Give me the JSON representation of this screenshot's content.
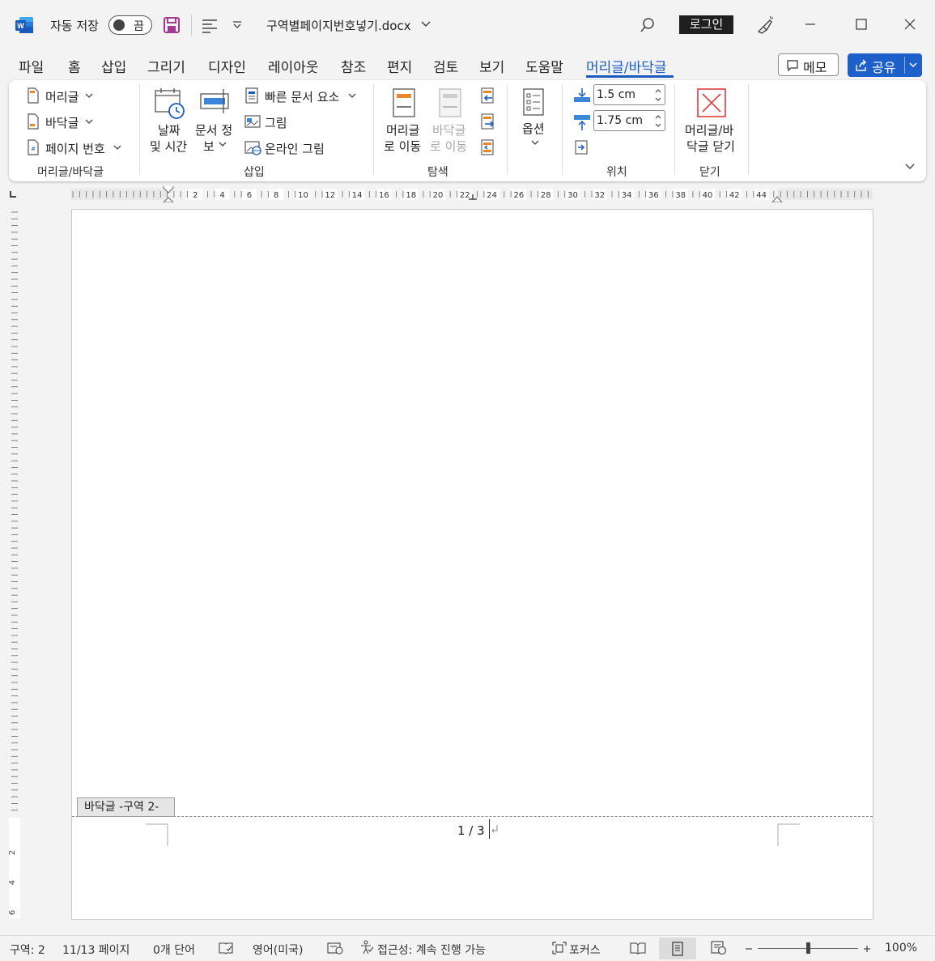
{
  "titlebar": {
    "autosave_label": "자동 저장",
    "autosave_state": "끔",
    "filename": "구역별페이지번호넣기.docx",
    "login_label": "로그인"
  },
  "tabs": [
    "파일",
    "홈",
    "삽입",
    "그리기",
    "디자인",
    "레이아웃",
    "참조",
    "편지",
    "검토",
    "보기",
    "도움말",
    "머리글/바닥글"
  ],
  "active_tab": "머리글/바닥글",
  "memo_label": "메모",
  "share_label": "공유",
  "ribbon": {
    "group1": {
      "header_label": "머리글",
      "footer_label": "바닥글",
      "page_number_label": "페이지 번호",
      "group_label": "머리글/바닥글"
    },
    "group2": {
      "date_time_line1": "날짜",
      "date_time_line2": "및 시간",
      "doc_info_line1": "문서 정",
      "doc_info_line2": "보",
      "quick_parts_label": "빠른 문서 요소",
      "picture_label": "그림",
      "online_picture_label": "온라인 그림",
      "group_label": "삽입"
    },
    "group3": {
      "goto_header_line1": "머리글",
      "goto_header_line2": "로 이동",
      "goto_footer_line1": "바닥글",
      "goto_footer_line2": "로 이동",
      "group_label": "탐색"
    },
    "group4": {
      "options_label": "옵션"
    },
    "group5": {
      "header_pos": "1.5 cm",
      "footer_pos": "1.75 cm",
      "group_label": "위치"
    },
    "group6": {
      "close_line1": "머리글/바",
      "close_line2": "닥글 닫기",
      "group_label": "닫기"
    }
  },
  "ruler_labels": [
    "2",
    "4",
    "6",
    "8",
    "10",
    "12",
    "14",
    "16",
    "18",
    "20",
    "22",
    "24",
    "26",
    "28",
    "30",
    "32",
    "34",
    "36",
    "38",
    "40",
    "42",
    "44"
  ],
  "vruler_labels": [
    "2",
    "4",
    "6"
  ],
  "document": {
    "footer_tag": "바닥글 -구역 2-",
    "footer_text": "1 / 3"
  },
  "statusbar": {
    "section": "구역: 2",
    "pages": "11/13 페이지",
    "words": "0개 단어",
    "language": "영어(미국)",
    "accessibility": "접근성: 계속 진행 가능",
    "focus": "포커스",
    "zoom": "100%"
  },
  "colors": {
    "accent": "#1a5bbf",
    "share_button": "#1e60c9",
    "close_x": "#e03a3a"
  }
}
